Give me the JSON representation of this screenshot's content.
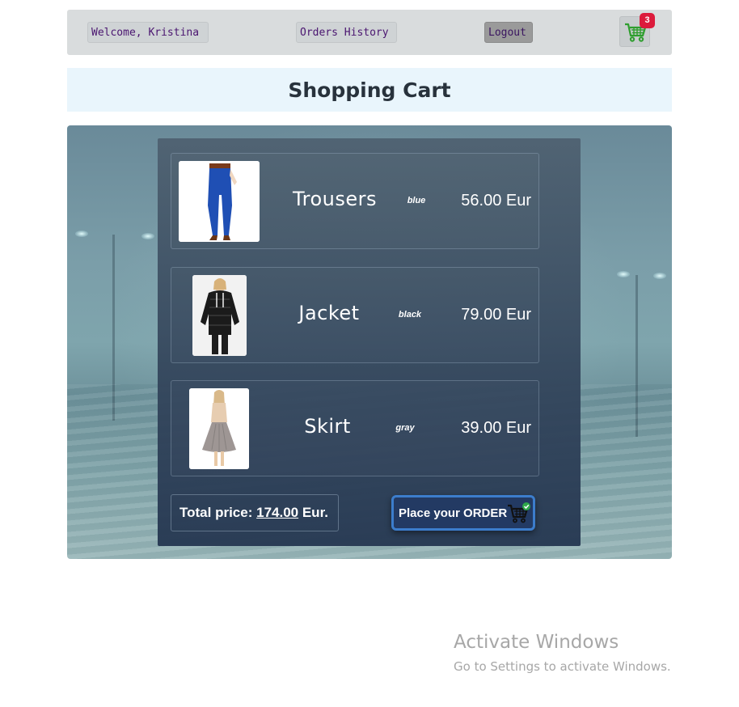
{
  "nav": {
    "welcome_label": "Welcome, Kristina",
    "orders_history_label": "Orders History",
    "logout_label": "Logout",
    "cart_icon": "shopping-cart-icon",
    "cart_count": "3",
    "cart_icon_color": "#2e9e2e",
    "badge_color": "#dc1b3c"
  },
  "page": {
    "title": "Shopping Cart"
  },
  "cart": {
    "items": [
      {
        "name": "Trousers",
        "color": "blue",
        "price": "56.00 Eur"
      },
      {
        "name": "Jacket",
        "color": "black",
        "price": "79.00 Eur"
      },
      {
        "name": "Skirt",
        "color": "gray",
        "price": "39.00 Eur"
      }
    ],
    "total_label": "Total price:",
    "total_amount": "174.00",
    "total_currency": "Eur.",
    "order_button_label": "Place your ORDER",
    "order_icon": "cart-check-icon"
  },
  "watermark": {
    "title": "Activate Windows",
    "subtitle": "Go to Settings to activate Windows."
  }
}
